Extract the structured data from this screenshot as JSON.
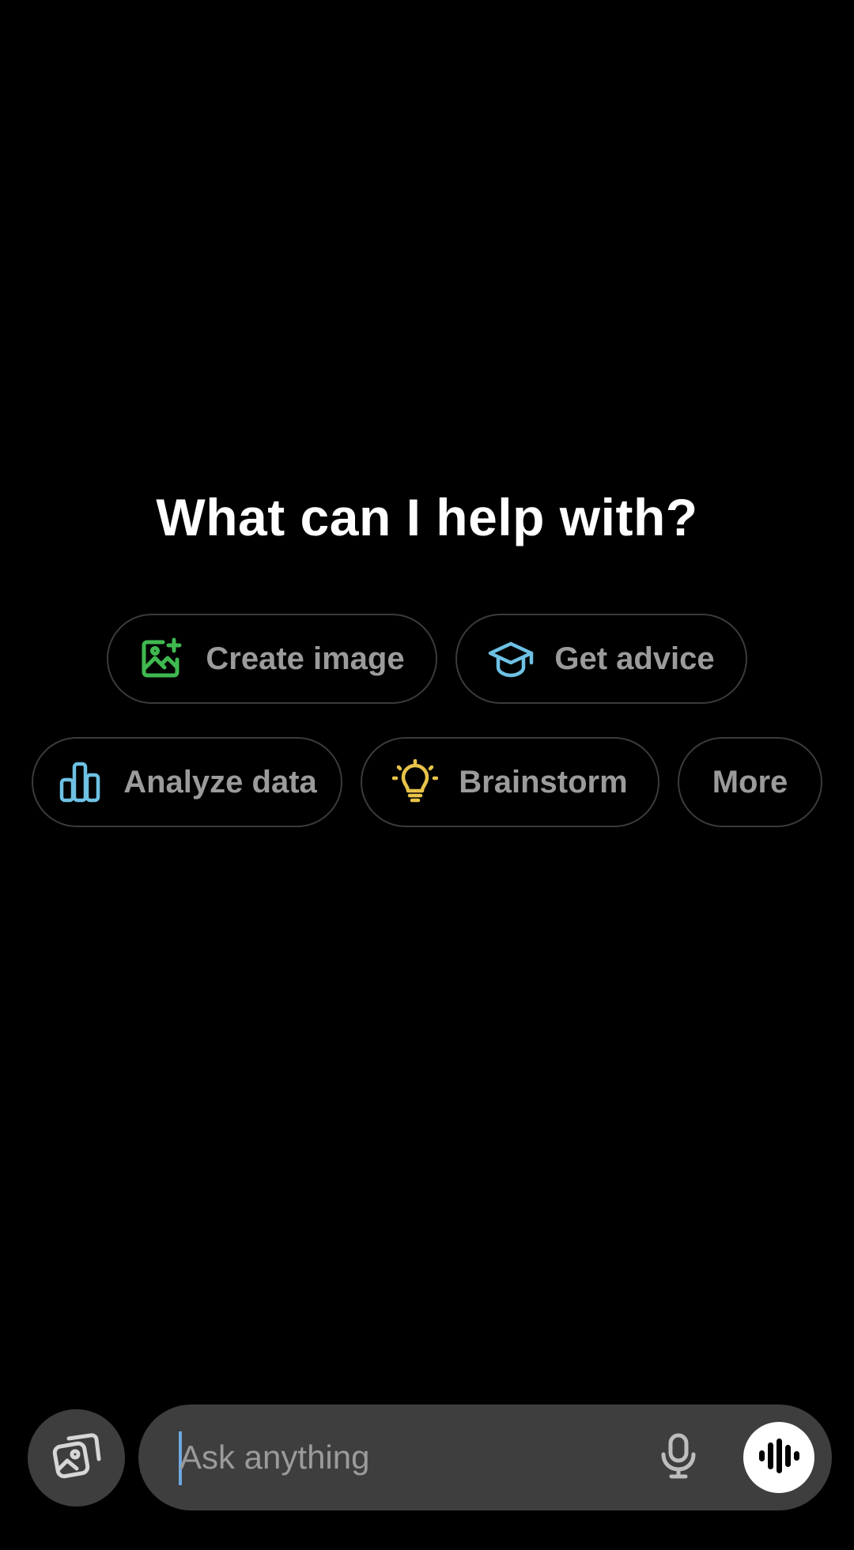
{
  "headline": "What can I help with?",
  "suggestions": [
    {
      "label": "Create image",
      "icon": "image-sparkle-icon",
      "color": "#3fb950"
    },
    {
      "label": "Get advice",
      "icon": "graduation-cap-icon",
      "color": "#6ec1e4"
    },
    {
      "label": "Analyze data",
      "icon": "bar-chart-icon",
      "color": "#6ec1e4"
    },
    {
      "label": "Brainstorm",
      "icon": "lightbulb-icon",
      "color": "#e8c34a"
    },
    {
      "label": "More"
    }
  ],
  "composer": {
    "placeholder": "Ask anything",
    "gallery_icon": "gallery-icon",
    "mic_icon": "microphone-icon",
    "voice_icon": "voice-waveform-icon"
  }
}
